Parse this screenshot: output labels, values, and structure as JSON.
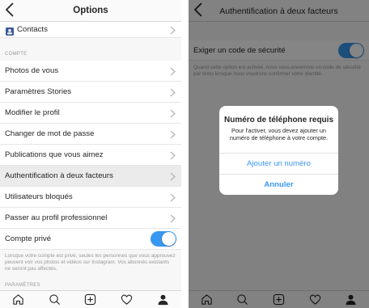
{
  "left": {
    "header": {
      "title": "Options"
    },
    "contacts_label": "Contacts",
    "section_compte": "COMPTE",
    "items": [
      {
        "label": "Photos de vous"
      },
      {
        "label": "Paramètres Stories"
      },
      {
        "label": "Modifier le profil"
      },
      {
        "label": "Changer de mot de passe"
      },
      {
        "label": "Publications que vous aimez"
      },
      {
        "label": "Authentification à deux facteurs"
      },
      {
        "label": "Utilisateurs bloqués"
      },
      {
        "label": "Passer au profil professionnel"
      }
    ],
    "private": {
      "label": "Compte privé",
      "enabled": true
    },
    "private_note": "Lorsque votre compte est privé, seules les personnes que vous approuvez peuvent voir vos photos et vidéos sur Instagram. Vos abonnés existants ne seront pas affectés.",
    "section_parametres": "PARAMÈTRES"
  },
  "right": {
    "header": {
      "title": "Authentification à deux facteurs"
    },
    "security_toggle": {
      "label": "Exiger un code de sécurité",
      "enabled": true
    },
    "security_note": "Quand cette option est activée, nous vous enverrons un code de sécurité par texto lorsque nous voudrons confirmer votre identité.",
    "dialog": {
      "title": "Numéro de téléphone requis",
      "message": "Pour l'activer, vous devez ajouter un numéro de téléphone à votre compte.",
      "primary": "Ajouter un numéro",
      "cancel": "Annuler"
    }
  },
  "tabbar": {
    "icons": [
      "home-icon",
      "search-icon",
      "add-icon",
      "heart-icon",
      "profile-icon"
    ]
  },
  "colors": {
    "accent": "#3897f0",
    "highlight": "#ebebeb",
    "muted": "#999999"
  }
}
